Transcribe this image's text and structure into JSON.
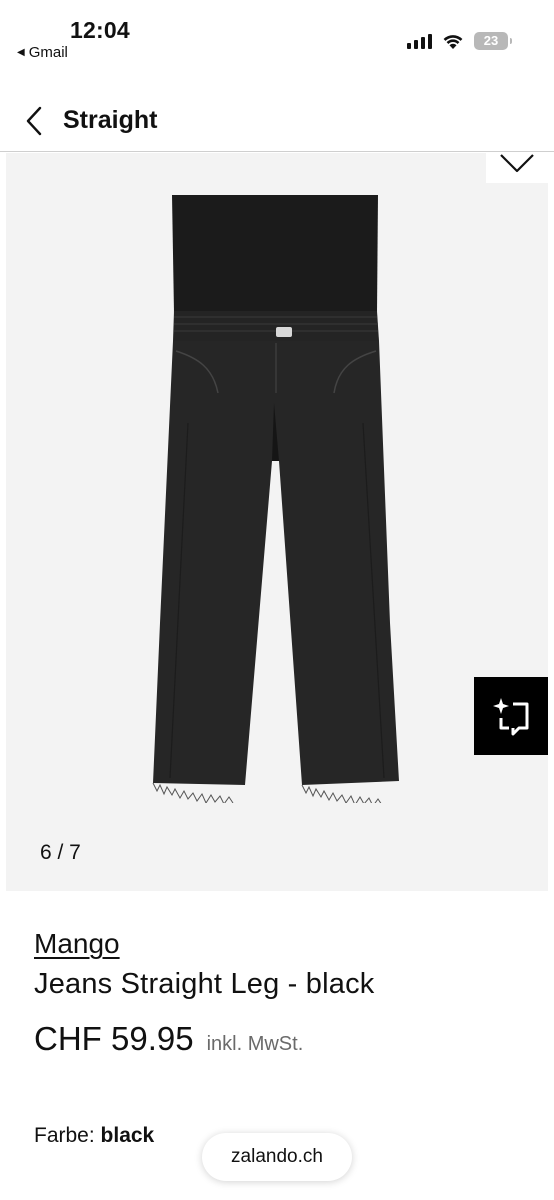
{
  "status_bar": {
    "time": "12:04",
    "back_app": "Gmail",
    "battery": "23"
  },
  "header": {
    "title": "Straight"
  },
  "gallery": {
    "counter": "6 / 7"
  },
  "product": {
    "brand": "Mango",
    "name": "Jeans Straight Leg - black",
    "price": "CHF 59.95",
    "tax_note": "inkl. MwSt.",
    "color_label": "Farbe:",
    "color_value": "black"
  },
  "browser": {
    "url": "zalando.ch"
  },
  "icons": {
    "back": "chevron-left-icon",
    "wishlist": "heart-icon",
    "style": "sparkle-frame-icon"
  }
}
